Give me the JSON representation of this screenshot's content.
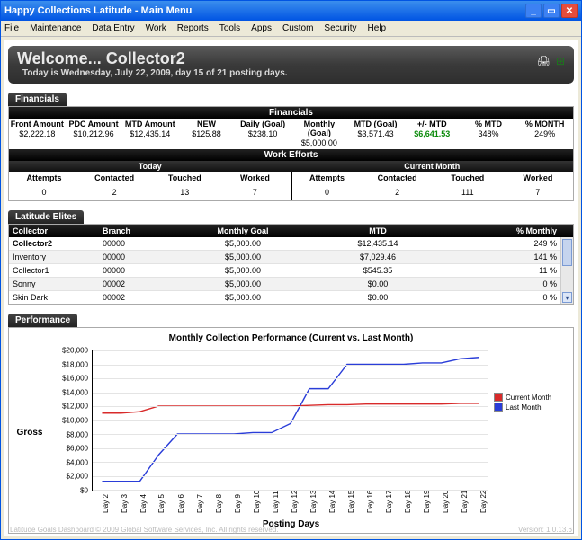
{
  "window": {
    "title": "Happy Collections  Latitude - Main Menu"
  },
  "menu": {
    "items": [
      "File",
      "Maintenance",
      "Data Entry",
      "Work",
      "Reports",
      "Tools",
      "Apps",
      "Custom",
      "Security",
      "Help"
    ]
  },
  "welcome": {
    "title": "Welcome... Collector2",
    "subtitle": "Today is Wednesday, July 22, 2009, day 15 of 21 posting days."
  },
  "tags": {
    "financials": "Financials",
    "elites": "Latitude Elites",
    "performance": "Performance"
  },
  "financials": {
    "heading": "Financials",
    "headers": [
      "Front Amount",
      "PDC Amount",
      "MTD Amount",
      "NEW",
      "Daily (Goal)",
      "Monthly (Goal)",
      "MTD (Goal)",
      "+/- MTD",
      "% MTD",
      "% MONTH"
    ],
    "values": [
      "$2,222.18",
      "$10,212.96",
      "$12,435.14",
      "$125.88",
      "$238.10",
      "$5,000.00",
      "$3,571.43",
      "$6,641.53",
      "348%",
      "249%"
    ]
  },
  "work_efforts": {
    "heading": "Work Efforts",
    "sub_today": "Today",
    "sub_month": "Current Month",
    "cols": [
      "Attempts",
      "Contacted",
      "Touched",
      "Worked"
    ],
    "today": [
      "0",
      "2",
      "13",
      "7"
    ],
    "month": [
      "0",
      "2",
      "111",
      "7"
    ]
  },
  "elites": {
    "headers": {
      "collector": "Collector",
      "branch": "Branch",
      "monthly_goal": "Monthly Goal",
      "mtd": "MTD",
      "pct": "% Monthly"
    },
    "rows": [
      {
        "collector": "Collector2",
        "branch": "00000",
        "monthly_goal": "$5,000.00",
        "mtd": "$12,435.14",
        "pct": "249 %"
      },
      {
        "collector": "Inventory",
        "branch": "00000",
        "monthly_goal": "$5,000.00",
        "mtd": "$7,029.46",
        "pct": "141 %"
      },
      {
        "collector": "Collector1",
        "branch": "00000",
        "monthly_goal": "$5,000.00",
        "mtd": "$545.35",
        "pct": "11 %"
      },
      {
        "collector": "Sonny",
        "branch": "00002",
        "monthly_goal": "$5,000.00",
        "mtd": "$0.00",
        "pct": "0 %"
      },
      {
        "collector": "Skin Dark",
        "branch": "00002",
        "monthly_goal": "$5,000.00",
        "mtd": "$0.00",
        "pct": "0 %"
      }
    ]
  },
  "chart_data": {
    "type": "line",
    "title": "Monthly Collection Performance (Current vs. Last Month)",
    "xlabel": "Posting Days",
    "ylabel": "Gross",
    "ylim": [
      0,
      20000
    ],
    "yticks": [
      0,
      2000,
      4000,
      6000,
      8000,
      10000,
      12000,
      14000,
      16000,
      18000,
      20000
    ],
    "ytick_labels": [
      "$0",
      "$2,000",
      "$4,000",
      "$6,000",
      "$8,000",
      "$10,000",
      "$12,000",
      "$14,000",
      "$16,000",
      "$18,000",
      "$20,000"
    ],
    "categories": [
      "Day 2",
      "Day 3",
      "Day 4",
      "Day 5",
      "Day 6",
      "Day 7",
      "Day 8",
      "Day 9",
      "Day 10",
      "Day 11",
      "Day 12",
      "Day 13",
      "Day 14",
      "Day 15",
      "Day 16",
      "Day 17",
      "Day 18",
      "Day 19",
      "Day 20",
      "Day 21",
      "Day 22"
    ],
    "series": [
      {
        "name": "Current Month",
        "color": "#d82a2a",
        "values": [
          11000,
          11000,
          11200,
          12000,
          12000,
          12000,
          12000,
          12000,
          12000,
          12000,
          12000,
          12100,
          12200,
          12200,
          12300,
          12300,
          12300,
          12300,
          12300,
          12400,
          12400
        ]
      },
      {
        "name": "Last Month",
        "color": "#2a3dd8",
        "values": [
          1200,
          1200,
          1200,
          5000,
          8000,
          8000,
          8000,
          8000,
          8200,
          8200,
          9500,
          14500,
          14500,
          18000,
          18000,
          18000,
          18000,
          18200,
          18200,
          18800,
          19000
        ]
      }
    ],
    "legend": [
      "Current Month",
      "Last Month"
    ]
  },
  "footer": {
    "left": "Latitude Goals Dashboard © 2009 Global Software Services, Inc. All rights reserved.",
    "right": "Version: 1.0.13.6"
  }
}
